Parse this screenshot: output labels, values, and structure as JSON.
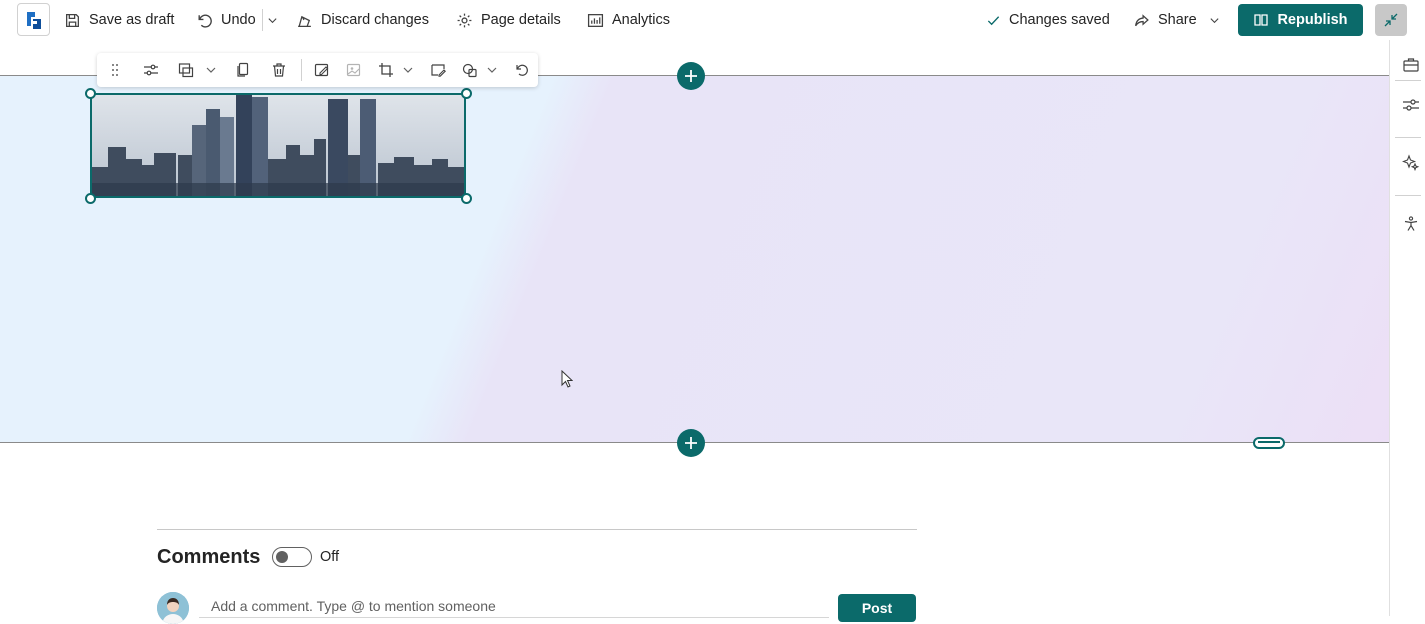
{
  "topbar": {
    "save_draft": "Save as draft",
    "undo": "Undo",
    "discard": "Discard changes",
    "page_details": "Page details",
    "analytics": "Analytics",
    "status": "Changes saved",
    "share": "Share",
    "republish": "Republish"
  },
  "image_toolbar": {
    "tools": [
      "drag-handle-icon",
      "settings-sliders-icon",
      "image-style-icon",
      "copy-icon",
      "delete-icon",
      "edit-image-icon",
      "remove-bg-icon",
      "crop-icon",
      "alt-text-icon",
      "shapes-icon",
      "reset-icon"
    ]
  },
  "colors": {
    "accent": "#0b6a6a",
    "section_left": "#e6f2fd",
    "section_right": "#e9e6f8"
  },
  "comments": {
    "title": "Comments",
    "toggle_state": "Off",
    "input_placeholder": "Add a comment. Type @ to mention someone",
    "post_label": "Post"
  }
}
